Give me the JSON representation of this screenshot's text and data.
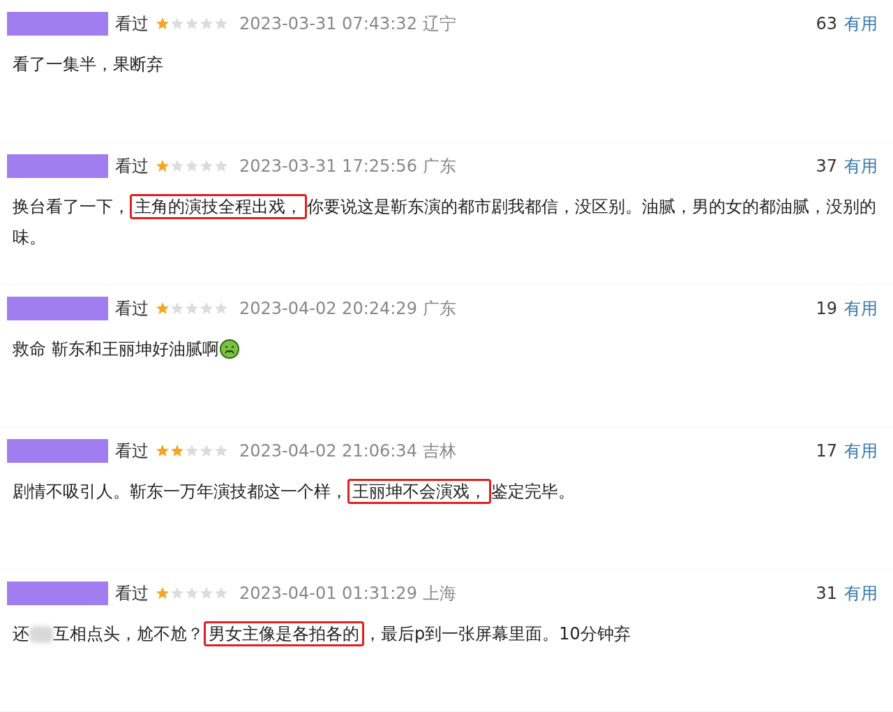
{
  "reviews": [
    {
      "status": "看过",
      "stars": 1,
      "time": "2023-03-31 07:43:32 辽宁",
      "votes": "63",
      "useful": "有用",
      "segments": [
        {
          "kind": "text",
          "text": "看了一集半，果断弃"
        }
      ]
    },
    {
      "status": "看过",
      "stars": 1,
      "time": "2023-03-31 17:25:56 广东",
      "votes": "37",
      "useful": "有用",
      "segments": [
        {
          "kind": "text",
          "text": "换台看了一下，"
        },
        {
          "kind": "highlight",
          "text": "主角的演技全程出戏，"
        },
        {
          "kind": "text",
          "text": "你要说这是靳东演的都市剧我都信，没区别。油腻，男的女的都油腻，没别的味。"
        }
      ]
    },
    {
      "status": "看过",
      "stars": 1,
      "time": "2023-04-02 20:24:29 广东",
      "votes": "19",
      "useful": "有用",
      "segments": [
        {
          "kind": "text",
          "text": "救命 靳东和王丽坤好油腻啊"
        },
        {
          "kind": "emoji"
        }
      ]
    },
    {
      "status": "看过",
      "stars": 2,
      "time": "2023-04-02 21:06:34 吉林",
      "votes": "17",
      "useful": "有用",
      "segments": [
        {
          "kind": "text",
          "text": "剧情不吸引人。靳东一万年演技都这一个样，"
        },
        {
          "kind": "highlight",
          "text": "王丽坤不会演戏，"
        },
        {
          "kind": "text",
          "text": "鉴定完毕。"
        }
      ]
    },
    {
      "status": "看过",
      "stars": 1,
      "time": "2023-04-01 01:31:29 上海",
      "votes": "31",
      "useful": "有用",
      "segments": [
        {
          "kind": "text",
          "text": "还"
        },
        {
          "kind": "blur"
        },
        {
          "kind": "text",
          "text": "互相点头，尬不尬？"
        },
        {
          "kind": "highlight",
          "text": "男女主像是各拍各的"
        },
        {
          "kind": "text",
          "text": "，最后p到一张屏幕里面。10分钟弃"
        }
      ]
    }
  ]
}
